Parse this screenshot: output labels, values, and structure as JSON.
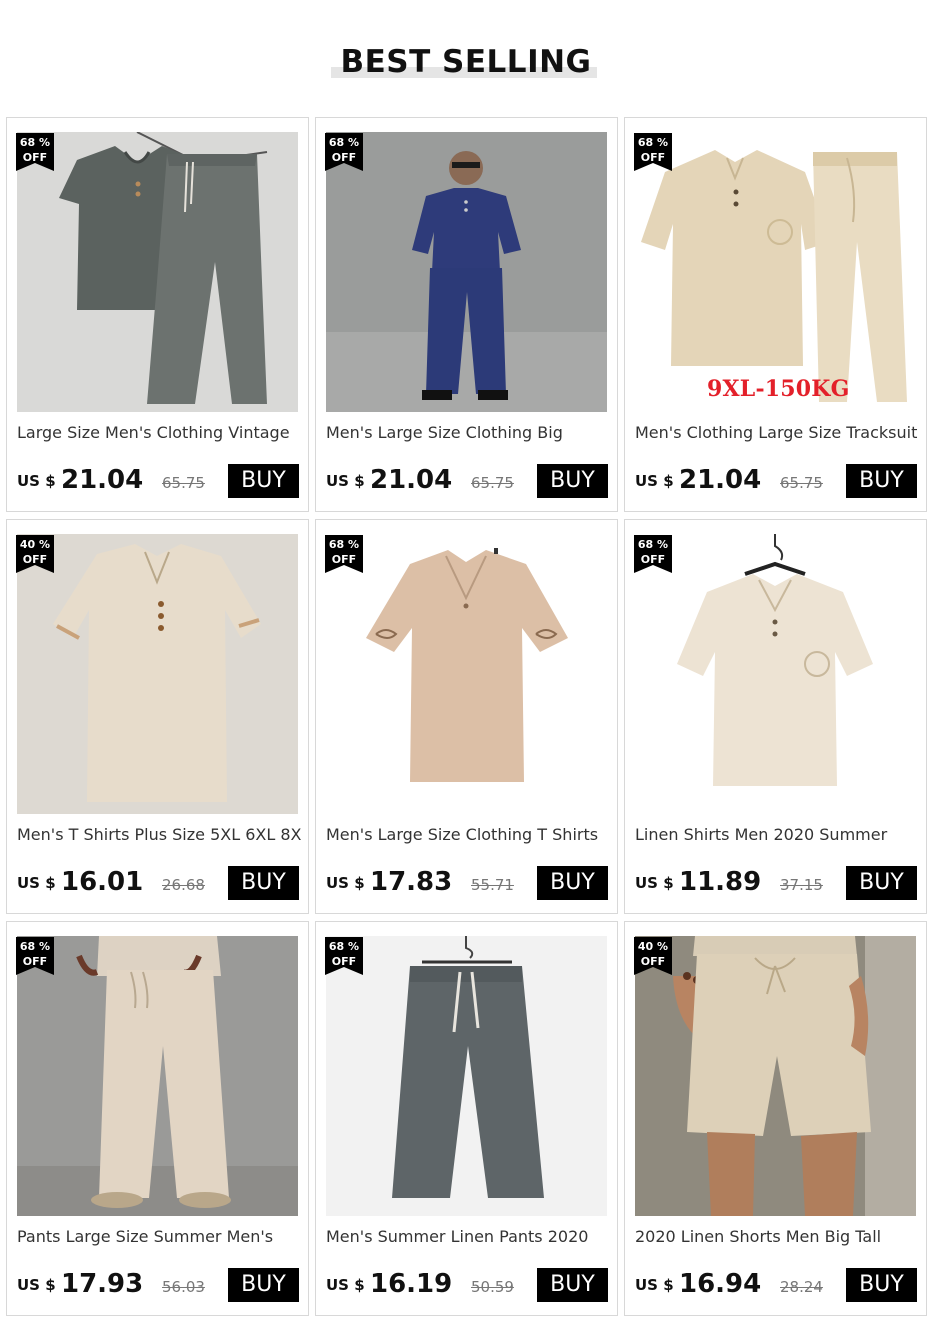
{
  "header": {
    "title": "BEST SELLING"
  },
  "products": [
    {
      "discount": "68 %",
      "off": "OFF",
      "title": "Large Size Men's Clothing Vintage",
      "currency": "US $",
      "price": "21.04",
      "old_price": "65.75",
      "buy_label": "BUY",
      "image": "gray-linen-set-on-hanger"
    },
    {
      "discount": "68 %",
      "off": "OFF",
      "title": "Men's Large Size Clothing Big",
      "currency": "US $",
      "price": "21.04",
      "old_price": "65.75",
      "buy_label": "BUY",
      "image": "man-in-blue-linen-set"
    },
    {
      "discount": "68 %",
      "off": "OFF",
      "title": "Men's Clothing Large Size Tracksuit",
      "currency": "US $",
      "price": "21.04",
      "old_price": "65.75",
      "buy_label": "BUY",
      "image": "beige-linen-set",
      "overlay": "9XL-150KG"
    },
    {
      "discount": "40 %",
      "off": "OFF",
      "title": "Men's T Shirts Plus Size 5XL 6XL 8XL",
      "currency": "US $",
      "price": "16.01",
      "old_price": "26.68",
      "buy_label": "BUY",
      "image": "beige-linen-tshirt-flat"
    },
    {
      "discount": "68 %",
      "off": "OFF",
      "title": "Men's Large Size Clothing T Shirts",
      "currency": "US $",
      "price": "17.83",
      "old_price": "55.71",
      "buy_label": "BUY",
      "image": "tan-embroidered-tshirt"
    },
    {
      "discount": "68 %",
      "off": "OFF",
      "title": "Linen Shirts Men 2020 Summer",
      "currency": "US $",
      "price": "11.89",
      "old_price": "37.15",
      "buy_label": "BUY",
      "image": "beige-shirt-on-hanger"
    },
    {
      "discount": "68 %",
      "off": "OFF",
      "title": "Pants Large Size Summer Men's",
      "currency": "US $",
      "price": "17.93",
      "old_price": "56.03",
      "buy_label": "BUY",
      "image": "beige-wide-pants-worn"
    },
    {
      "discount": "68 %",
      "off": "OFF",
      "title": "Men's Summer Linen Pants 2020",
      "currency": "US $",
      "price": "16.19",
      "old_price": "50.59",
      "buy_label": "BUY",
      "image": "gray-cropped-pants-on-hanger"
    },
    {
      "discount": "40 %",
      "off": "OFF",
      "title": "2020 Linen Shorts Men Big Tall",
      "currency": "US $",
      "price": "16.94",
      "old_price": "28.24",
      "buy_label": "BUY",
      "image": "beige-linen-shorts-worn"
    }
  ]
}
